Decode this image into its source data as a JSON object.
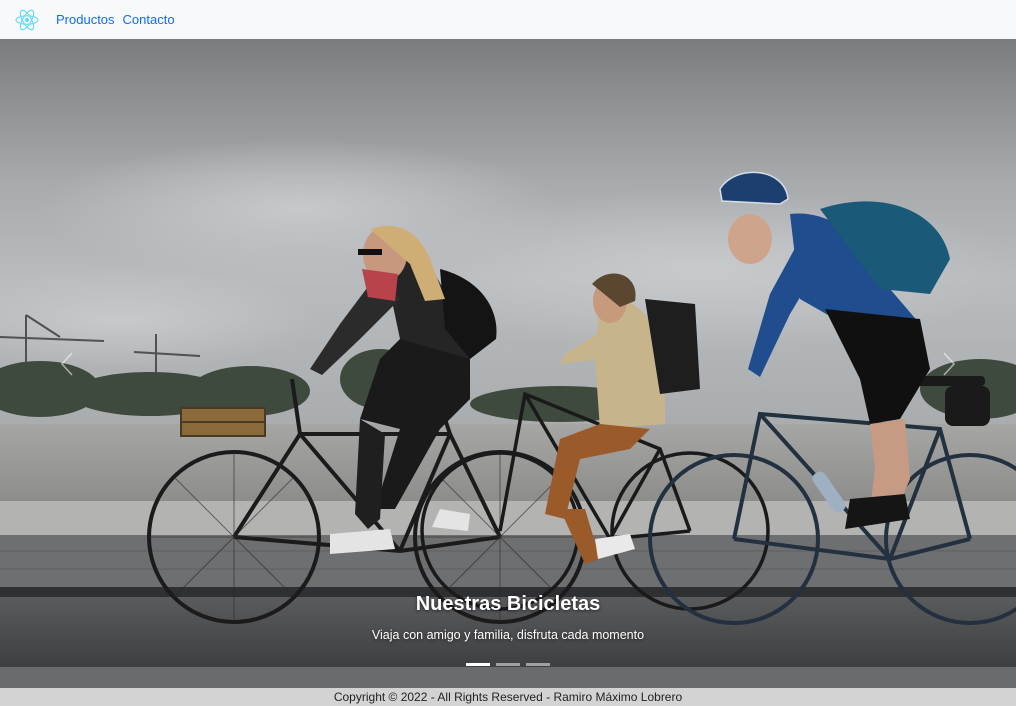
{
  "navbar": {
    "brand_icon": "react-logo-icon",
    "brand_color": "#61dafb",
    "links": [
      {
        "label": "Productos"
      },
      {
        "label": "Contacto"
      }
    ],
    "link_color": "#0d6efd"
  },
  "carousel": {
    "slide_image": "cyclists-photo",
    "caption": {
      "title": "Nuestras Bicicletas",
      "text": "Viaja con amigo y familia, disfruta cada momento"
    },
    "indicators_count": 3,
    "active_indicator": 1,
    "prev_icon": "chevron-left-icon",
    "next_icon": "chevron-right-icon"
  },
  "footer": {
    "text": "Copyright © 2022 - All Rights Reserved - Ramiro Máximo Lobrero"
  }
}
